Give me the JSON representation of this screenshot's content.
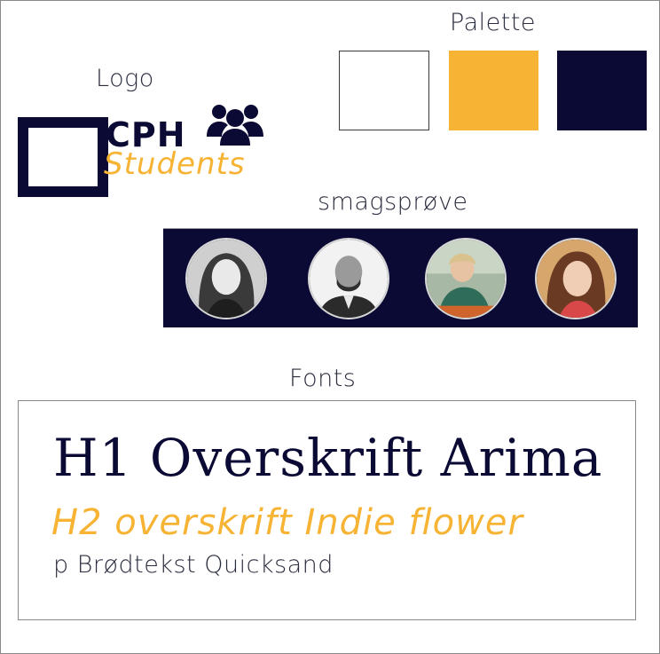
{
  "titles": {
    "palette": "Palette",
    "logo": "Logo",
    "sample": "smagsprøve",
    "fonts": "Fonts"
  },
  "logo": {
    "line1": "CPH",
    "line2": "Students",
    "icon": "people-group-icon"
  },
  "palette": {
    "colors": [
      "#ffffff",
      "#f7b334",
      "#0a0a34"
    ]
  },
  "sample": {
    "avatars": [
      "person-photo",
      "person-photo",
      "person-photo",
      "person-photo"
    ]
  },
  "fonts": {
    "h1": "H1 Overskrift Arima",
    "h2": "H2 overskrift Indie flower",
    "p": "p Brødtekst Quicksand"
  }
}
